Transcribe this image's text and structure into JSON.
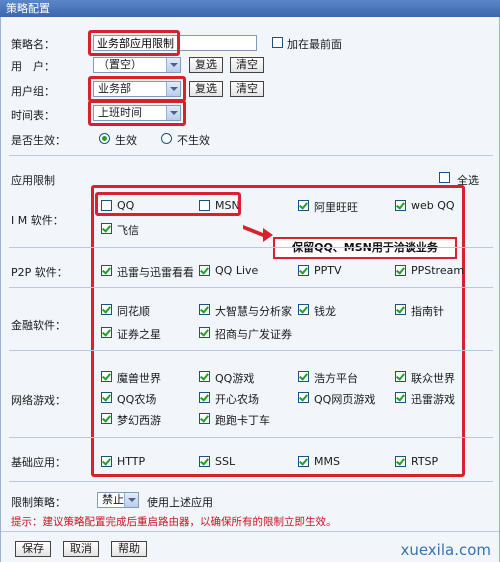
{
  "window": {
    "title": "策略配置"
  },
  "policy_name": {
    "label": "策略名：",
    "value": "业务部应用限制"
  },
  "add_top": {
    "label": "加在最前面"
  },
  "user": {
    "label": "用　户：",
    "selected": "（置空）",
    "copy_label": "复选",
    "clear_label": "清空"
  },
  "group": {
    "label": "用户组：",
    "selected": "业务部",
    "copy_label": "复选",
    "clear_label": "清空"
  },
  "schedule": {
    "label": "时间表：",
    "selected": "上班时间"
  },
  "enabled": {
    "label": "是否生效：",
    "on_label": "生效",
    "off_label": "不生效",
    "value": "生效"
  },
  "app_limit": {
    "label": "应用限制",
    "select_all_label": "全选"
  },
  "categories": [
    {
      "label": "I M 软件：",
      "apps": [
        {
          "name": "QQ",
          "checked": false
        },
        {
          "name": "MSN",
          "checked": false
        },
        {
          "name": "阿里旺旺",
          "checked": true
        },
        {
          "name": "web QQ",
          "checked": true
        },
        {
          "name": "飞信",
          "checked": true
        }
      ]
    },
    {
      "label": "P2P 软件：",
      "apps": [
        {
          "name": "迅雷与迅雷看看",
          "checked": true
        },
        {
          "name": "QQ Live",
          "checked": true
        },
        {
          "name": "PPTV",
          "checked": true
        },
        {
          "name": "PPStream",
          "checked": true
        }
      ]
    },
    {
      "label": "金融软件：",
      "apps": [
        {
          "name": "同花顺",
          "checked": true
        },
        {
          "name": "大智慧与分析家",
          "checked": true
        },
        {
          "name": "钱龙",
          "checked": true
        },
        {
          "name": "指南针",
          "checked": true
        },
        {
          "name": "证券之星",
          "checked": true
        },
        {
          "name": "招商与广发证券",
          "checked": true
        }
      ]
    },
    {
      "label": "网络游戏：",
      "apps": [
        {
          "name": "魔兽世界",
          "checked": true
        },
        {
          "name": "QQ游戏",
          "checked": true
        },
        {
          "name": "浩方平台",
          "checked": true
        },
        {
          "name": "联众世界",
          "checked": true
        },
        {
          "name": "QQ农场",
          "checked": true
        },
        {
          "name": "开心农场",
          "checked": true
        },
        {
          "name": "QQ网页游戏",
          "checked": true
        },
        {
          "name": "迅雷游戏",
          "checked": true
        },
        {
          "name": "梦幻西游",
          "checked": true
        },
        {
          "name": "跑跑卡丁车",
          "checked": true
        }
      ]
    },
    {
      "label": "基础应用：",
      "apps": [
        {
          "name": "HTTP",
          "checked": true
        },
        {
          "name": "SSL",
          "checked": true
        },
        {
          "name": "MMS",
          "checked": true
        },
        {
          "name": "RTSP",
          "checked": true
        }
      ]
    }
  ],
  "annotation": "保留QQ、MSN用于洽谈业务",
  "limit_policy": {
    "label": "限制策略：",
    "selected": "禁止",
    "suffix": "使用上述应用"
  },
  "hint": "提示：建议策略配置完成后重启路由器，以确保所有的限制立即生效。",
  "footer": {
    "save_label": "保存",
    "cancel_label": "取消",
    "help_label": "帮助"
  },
  "watermark": "xuexila.com",
  "colors": {
    "highlight": "#d8212c",
    "check": "#21a121",
    "title_bar": "#3c66ad",
    "hint": "#c8141e"
  }
}
